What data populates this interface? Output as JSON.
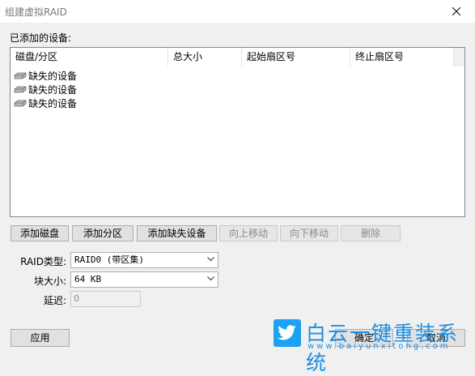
{
  "window": {
    "title": "组建虚拟RAID"
  },
  "section_label": "已添加的设备:",
  "list": {
    "columns": [
      "磁盘/分区",
      "总大小",
      "起始扇区号",
      "终止扇区号"
    ],
    "rows": [
      {
        "name": "缺失的设备"
      },
      {
        "name": "缺失的设备"
      },
      {
        "name": "缺失的设备"
      }
    ]
  },
  "buttons": {
    "add_disk": "添加磁盘",
    "add_partition": "添加分区",
    "add_missing": "添加缺失设备",
    "move_up": "向上移动",
    "move_down": "向下移动",
    "delete": "删除",
    "apply": "应用",
    "ok": "确定",
    "cancel": "取消"
  },
  "form": {
    "raid_type_label": "RAID类型:",
    "raid_type_value": "RAID0 (带区集)",
    "block_size_label": "块大小:",
    "block_size_value": "64 KB",
    "delay_label": "延迟:",
    "delay_value": "0"
  },
  "watermark": {
    "text": "白云一键重装系统",
    "url": "www.baiyunxitong.com"
  },
  "colors": {
    "watermark": "#1a8ee0",
    "logo": "#1da1f2"
  }
}
